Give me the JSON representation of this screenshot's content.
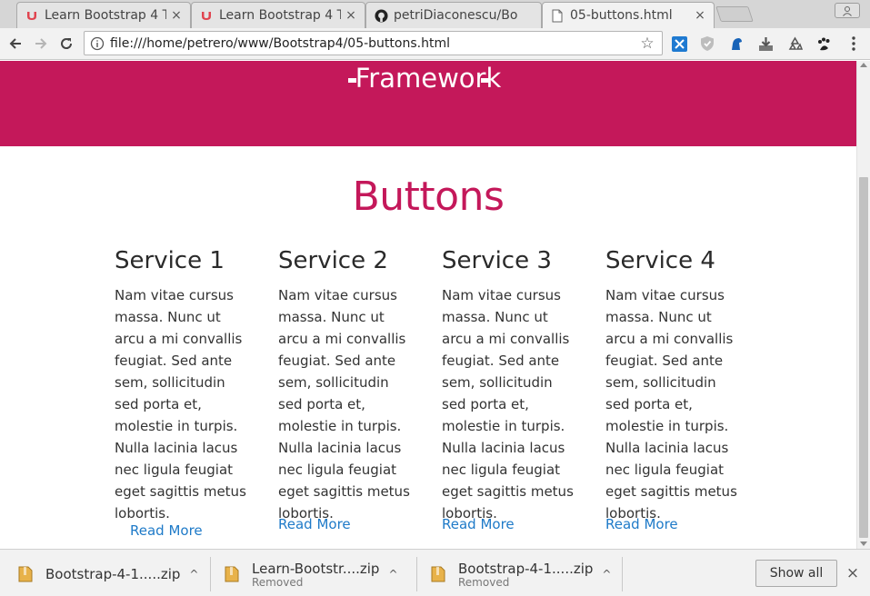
{
  "tabs": [
    {
      "title": "Learn Bootstrap 4 T",
      "favicon": "udemy-icon",
      "active": false
    },
    {
      "title": "Learn Bootstrap 4 T",
      "favicon": "udemy-icon",
      "active": false
    },
    {
      "title": "petriDiaconescu/Bo",
      "favicon": "github-icon",
      "active": false
    },
    {
      "title": "05-buttons.html",
      "favicon": "page-icon",
      "active": true
    }
  ],
  "tab_close_glyph": "×",
  "toolbar": {
    "url": "file:///home/petrero/www/Bootstrap4/05-buttons.html",
    "star_glyph": "☆"
  },
  "page": {
    "hero_subtitle": "Framework",
    "section_title": "Buttons",
    "services": [
      {
        "title": "Service 1",
        "text": "Nam vitae cursus massa. Nunc ut arcu a mi convallis feugiat. Sed ante sem, sollicitudin sed porta et, molestie in turpis. Nulla lacinia lacus nec ligula feugiat eget sagittis metus lobortis.",
        "link": "Read More"
      },
      {
        "title": "Service 2",
        "text": "Nam vitae cursus massa. Nunc ut arcu a mi convallis feugiat. Sed ante sem, sollicitudin sed porta et, molestie in turpis. Nulla lacinia lacus nec ligula feugiat eget sagittis metus lobortis.",
        "link": "Read More"
      },
      {
        "title": "Service 3",
        "text": "Nam vitae cursus massa. Nunc ut arcu a mi convallis feugiat. Sed ante sem, sollicitudin sed porta et, molestie in turpis. Nulla lacinia lacus nec ligula feugiat eget sagittis metus lobortis.",
        "link": "Read More"
      },
      {
        "title": "Service 4",
        "text": "Nam vitae cursus massa. Nunc ut arcu a mi convallis feugiat. Sed ante sem, sollicitudin sed porta et, molestie in turpis. Nulla lacinia lacus nec ligula feugiat eget sagittis metus lobortis.",
        "link": "Read More"
      }
    ]
  },
  "downloads": {
    "items": [
      {
        "filename": "Bootstrap-4-1.....zip",
        "status": ""
      },
      {
        "filename": "Learn-Bootstr....zip",
        "status": "Removed"
      },
      {
        "filename": "Bootstrap-4-1.....zip",
        "status": "Removed"
      }
    ],
    "show_all_label": "Show all",
    "chevron_glyph": "^",
    "close_glyph": "×"
  },
  "colors": {
    "brand": "#c4185a",
    "link": "#1e7ac8"
  }
}
